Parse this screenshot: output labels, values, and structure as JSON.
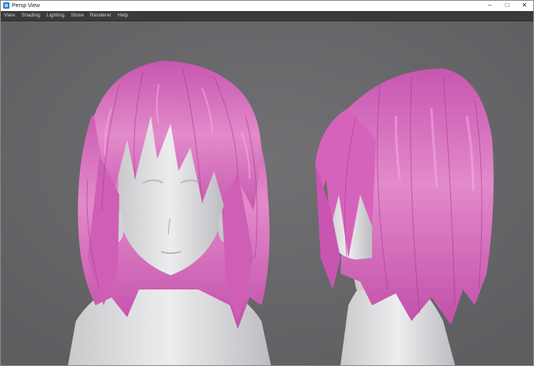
{
  "window": {
    "title": "Persp View",
    "controls": {
      "minimize": "–",
      "maximize": "□",
      "close": "✕"
    }
  },
  "menu": {
    "items": [
      "View",
      "Shading",
      "Lighting",
      "Show",
      "Renderer",
      "Help"
    ]
  },
  "viewport": {
    "background_color": "#6a6a6c",
    "hair_color": "#d96ac0",
    "skin_color": "#dcdcde",
    "models": [
      "front-view-model",
      "side-view-model"
    ]
  }
}
